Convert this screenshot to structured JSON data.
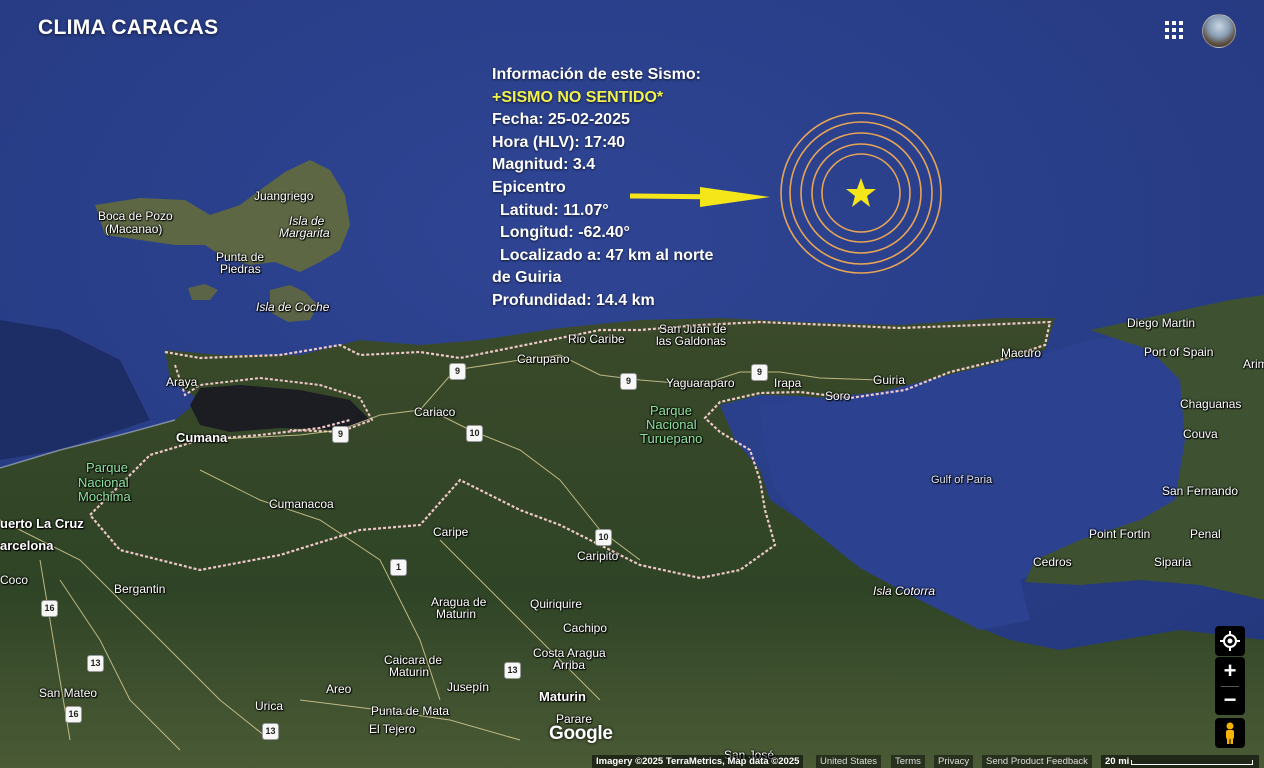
{
  "header": {
    "title": "CLIMA CARACAS",
    "apps_icon": "grid-apps-icon",
    "avatar_icon": "profile-avatar"
  },
  "info": {
    "heading": "Información de este Sismo:",
    "status": "+SISMO NO SENTIDO*",
    "fecha": "Fecha: 25-02-2025",
    "hora": "Hora (HLV): 17:40",
    "magnitud": "Magnitud: 3.4",
    "epicentro": "Epicentro",
    "latitud": "Latitud: 11.07°",
    "longitud": "Longitud: -62.40°",
    "localizado": "Localizado a: 47 km al norte",
    "localizado2": "de Guiria",
    "profundidad": "Profundidad: 14.4 km",
    "accent_color": "#f3f24b"
  },
  "colors": {
    "sea": "#2b3f8a",
    "land": "#3b4a2a",
    "boundary": "#f0c8c8",
    "rings": "#e8a455",
    "star": "#f5e61a",
    "arrow": "#f5e61a"
  },
  "places": {
    "boca": "Boca de Pozo",
    "macanao": "(Macanao)",
    "juangriego": "Juangriego",
    "isla_margarita": "Isla de",
    "isla_margarita2": "Margarita",
    "punta_piedras": "Punta de",
    "punta_piedras2": "Piedras",
    "coche": "Isla de Coche",
    "araya": "Araya",
    "cumana": "Cumana",
    "carupano": "Carupano",
    "rio_caribe": "Rio Caribe",
    "san_juan": "San Juan de",
    "san_juan2": "las Galdonas",
    "cariaco": "Cariaco",
    "yaguaraparo": "Yaguaraparo",
    "irapa": "Irapa",
    "soro": "Soro",
    "guiria": "Guiria",
    "macuro": "Macuro",
    "park1": "Parque",
    "park1b": "Nacional",
    "park1c": "Turuepano",
    "park2": "Parque",
    "park2b": "Nacional",
    "park2c": "Mochima",
    "diego": "Diego Martin",
    "port": "Port of Spain",
    "arima": "Arim",
    "chaguanas": "Chaguanas",
    "couva": "Couva",
    "gulf": "Gulf of Paria",
    "sanfernando": "San Fernando",
    "point": "Point Fortin",
    "penal": "Penal",
    "cedros": "Cedros",
    "siparia": "Siparia",
    "cumanacoa": "Cumanacoa",
    "puerto": "uerto La Cruz",
    "barcelona": "arcelona",
    "coco": "Coco",
    "caripe": "Caripe",
    "caripito": "Caripito",
    "bergantin": "Bergantin",
    "aragua": "Aragua de",
    "aragua2": "Maturin",
    "quiriquire": "Quiriquire",
    "cachipo": "Cachipo",
    "costa": "Costa Aragua",
    "costa2": "Arriba",
    "caicara": "Caicara de",
    "caicara2": "Maturin",
    "areo": "Areo",
    "jusepin": "Jusepín",
    "maturin": "Maturin",
    "sanmateo": "San Mateo",
    "urica": "Urica",
    "punta_mata": "Punta de Mata",
    "tejero": "El Tejero",
    "parare": "Parare",
    "cotorra": "Isla Cotorra",
    "sanjose": "San José"
  },
  "roads": {
    "r9a": "9",
    "r9b": "9",
    "r9c": "9",
    "r9d": "9",
    "r10a": "10",
    "r10b": "10",
    "r1": "1",
    "r16a": "16",
    "r16b": "16",
    "r13a": "13",
    "r13b": "13",
    "r13c": "13"
  },
  "map_controls": {
    "locate_icon": "my-location-icon",
    "zoom_in": "+",
    "zoom_out": "−",
    "pegman_icon": "street-view-pegman-icon"
  },
  "footer": {
    "google": "Google",
    "attribution": "Imagery ©2025 TerraMetrics, Map data ©2025",
    "united_states": "United States",
    "terms": "Terms",
    "privacy": "Privacy",
    "feedback": "Send Product Feedback",
    "scale": "20 mi"
  }
}
